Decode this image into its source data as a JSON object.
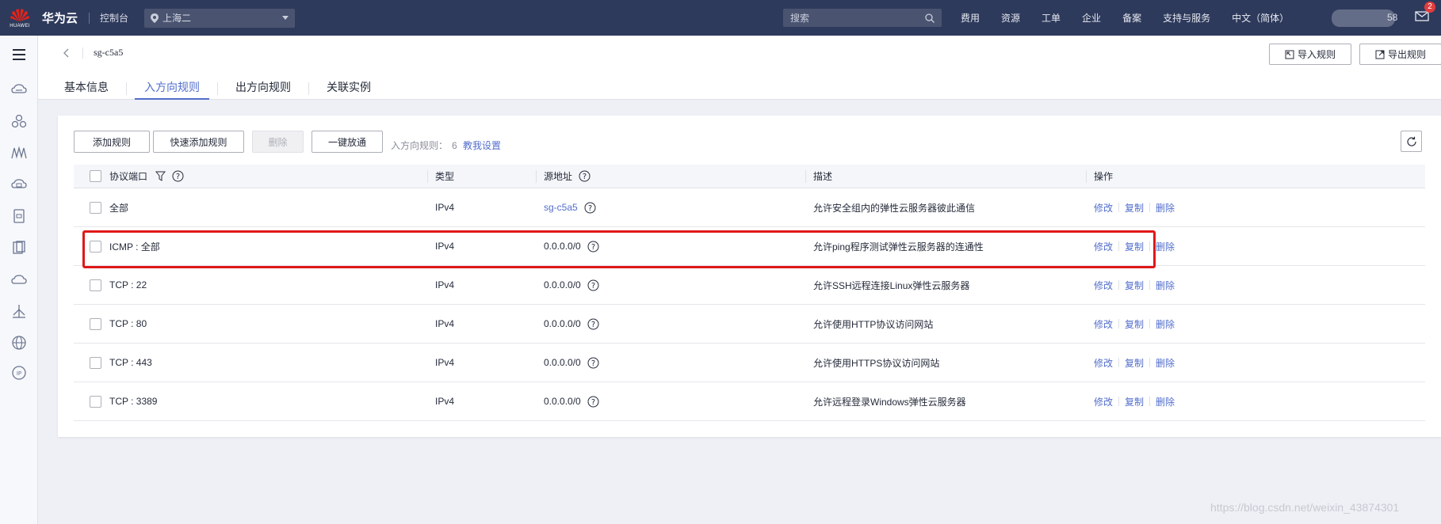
{
  "topbar": {
    "logo_text": "HUAWEI",
    "brand": "华为云",
    "console": "控制台",
    "region": "上海二",
    "search_placeholder": "搜索",
    "nav": [
      "费用",
      "资源",
      "工单",
      "企业",
      "备案",
      "支持与服务",
      "中文（简体）"
    ],
    "user_suffix": "58",
    "mail_badge": "2"
  },
  "sidebar": {
    "icons": [
      "cloud-server-icon",
      "cluster-icon",
      "monitor-icon",
      "database-icon",
      "storage-icon",
      "image-icon",
      "cloud-icon",
      "vpn-icon",
      "globe-icon",
      "eip-icon"
    ]
  },
  "header": {
    "title": "sg-c5a5",
    "import_label": "导入规则",
    "export_label": "导出规则",
    "tabs": [
      "基本信息",
      "入方向规则",
      "出方向规则",
      "关联实例"
    ]
  },
  "toolbar": {
    "add": "添加规则",
    "quick_add": "快速添加规则",
    "delete": "删除",
    "allow_all": "一键放通",
    "count_label": "入方向规则：",
    "count": "6",
    "help": "教我设置"
  },
  "table": {
    "headers": [
      "协议端口",
      "类型",
      "源地址",
      "描述",
      "操作"
    ],
    "rows": [
      {
        "port": "全部",
        "type": "IPv4",
        "source": "sg-c5a5",
        "desc": "允许安全组内的弹性云服务器彼此通信"
      },
      {
        "port": "ICMP : 全部",
        "type": "IPv4",
        "source": "0.0.0.0/0",
        "desc": "允许ping程序测试弹性云服务器的连通性"
      },
      {
        "port": "TCP : 22",
        "type": "IPv4",
        "source": "0.0.0.0/0",
        "desc": "允许SSH远程连接Linux弹性云服务器"
      },
      {
        "port": "TCP : 80",
        "type": "IPv4",
        "source": "0.0.0.0/0",
        "desc": "允许使用HTTP协议访问网站"
      },
      {
        "port": "TCP : 443",
        "type": "IPv4",
        "source": "0.0.0.0/0",
        "desc": "允许使用HTTPS协议访问网站"
      },
      {
        "port": "TCP : 3389",
        "type": "IPv4",
        "source": "0.0.0.0/0",
        "desc": "允许远程登录Windows弹性云服务器"
      }
    ],
    "actions": [
      "修改",
      "复制",
      "删除"
    ]
  },
  "watermark": "https://blog.csdn.net/weixin_43874301",
  "colors": {
    "topbar": "#2e3a5c",
    "accent": "#526ecc",
    "highlight": "#e01818"
  }
}
